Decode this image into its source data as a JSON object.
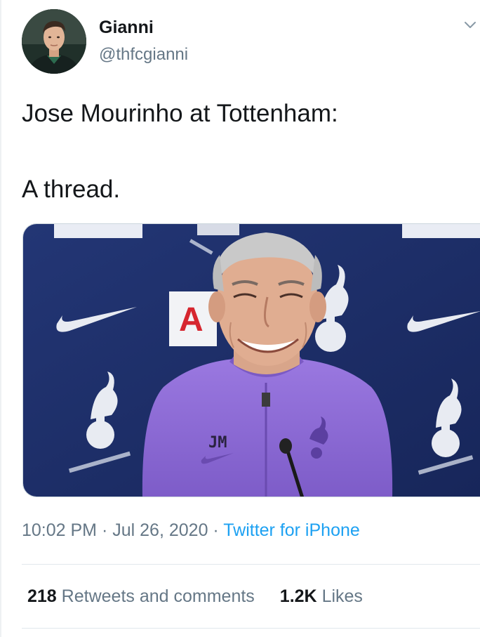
{
  "author": {
    "name": "Gianni",
    "handle": "@thfcgianni"
  },
  "tweet": {
    "line1": "Jose Mourinho at Tottenham:",
    "line2": "A thread."
  },
  "media": {
    "jersey_initials": "JM",
    "sponsor_fragment": "A"
  },
  "meta": {
    "time": "10:02 PM",
    "separator": "·",
    "date": "Jul 26, 2020",
    "source": "Twitter for iPhone"
  },
  "stats": {
    "retweets_count": "218",
    "retweets_label": "Retweets and comments",
    "likes_count": "1.2K",
    "likes_label": "Likes"
  },
  "colors": {
    "text": "#14171a",
    "secondary": "#657786",
    "link": "#1da1f2",
    "backdrop": "#1f2e6b",
    "shirt": "#8d6bd6"
  },
  "icons": {
    "menu": "chevron-down-icon",
    "brand": "nike-swoosh-icon",
    "crest": "cockerel-crest-icon"
  }
}
